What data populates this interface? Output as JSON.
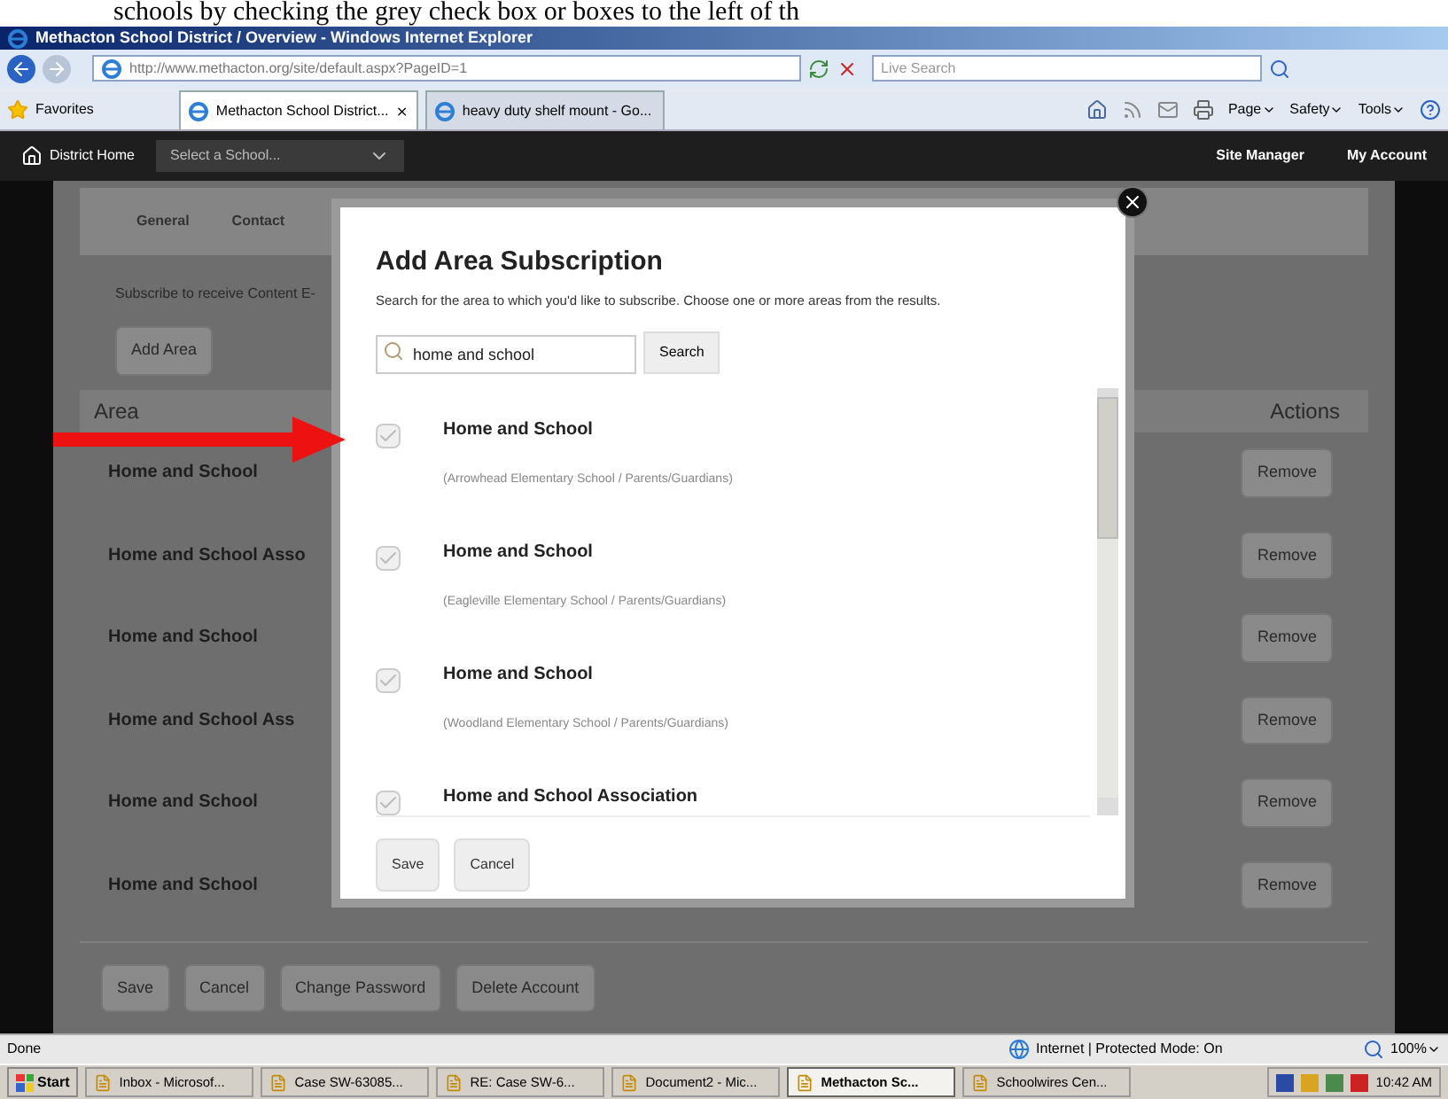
{
  "document_text": "schools by checking the grey check box or boxes to the left of th",
  "window": {
    "title": "Methacton School District / Overview - Windows Internet Explorer"
  },
  "address_bar": {
    "url": "http://www.methacton.org/site/default.aspx?PageID=1",
    "search_placeholder": "Live Search"
  },
  "favorites": {
    "label": "Favorites"
  },
  "browser_tabs": [
    {
      "label": "Methacton School District...",
      "selected": true
    },
    {
      "label": "heavy duty shelf mount - Go...",
      "selected": false
    }
  ],
  "command_bar": [
    "Page",
    "Safety",
    "Tools"
  ],
  "site_nav": {
    "home": "District Home",
    "school_select": "Select a School...",
    "links": [
      "Site Manager",
      "My Account"
    ]
  },
  "page": {
    "tabs": [
      "General",
      "Contact"
    ],
    "intro": "Subscribe to receive Content E-",
    "add_area": "Add Area",
    "columns": [
      "Area",
      "Actions"
    ],
    "rows": [
      {
        "area": "Home and School",
        "action": "Remove"
      },
      {
        "area": "Home and School Asso",
        "action": "Remove"
      },
      {
        "area": "Home and School",
        "action": "Remove"
      },
      {
        "area": "Home and School Ass",
        "action": "Remove"
      },
      {
        "area": "Home and School",
        "action": "Remove"
      },
      {
        "area": "Home and School",
        "action": "Remove"
      }
    ],
    "buttons": [
      "Save",
      "Cancel",
      "Change Password",
      "Delete Account"
    ]
  },
  "dialog": {
    "title": "Add Area Subscription",
    "description": "Search for the area to which you'd like to subscribe. Choose one or more areas from the results.",
    "search": {
      "value": "home and school",
      "button": "Search"
    },
    "results": [
      {
        "name": "Home and School",
        "location": "(Arrowhead Elementary School / Parents/Guardians)",
        "checked": true
      },
      {
        "name": "Home and School",
        "location": "(Eagleville Elementary School / Parents/Guardians)",
        "checked": true
      },
      {
        "name": "Home and School",
        "location": "(Woodland Elementary School / Parents/Guardians)",
        "checked": true
      },
      {
        "name": "Home and School Association",
        "checked": true
      }
    ],
    "buttons": [
      "Save",
      "Cancel"
    ]
  },
  "status_bar": {
    "text": "Done",
    "zone": "Internet | Protected Mode: On",
    "zoom": "100%"
  },
  "taskbar": {
    "start": "Start",
    "items": [
      {
        "label": "Inbox - Microsof...",
        "selected": false
      },
      {
        "label": "Case SW-63085...",
        "selected": false
      },
      {
        "label": "RE: Case SW-6...",
        "selected": false
      },
      {
        "label": "Document2 - Mic...",
        "selected": false
      },
      {
        "label": "Methacton Sc...",
        "selected": true
      },
      {
        "label": "Schoolwires Cen...",
        "selected": false
      }
    ],
    "clock": "10:42 AM"
  }
}
